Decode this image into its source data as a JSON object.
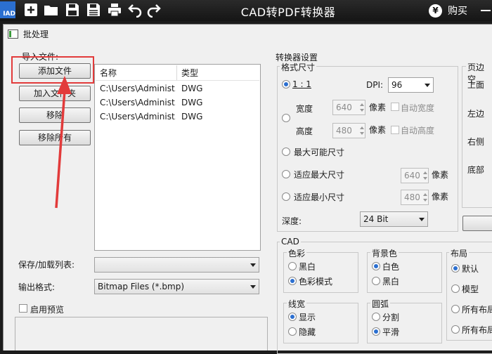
{
  "app": {
    "logo_text": "IAD",
    "title": "CAD转PDF转换器",
    "buy_symbol": "¥",
    "buy_label": "购买",
    "toolbar_icons": [
      "new-icon",
      "open-folder-icon",
      "save-icon",
      "save-as-icon",
      "print-icon",
      "undo-icon",
      "redo-icon"
    ]
  },
  "dialog": {
    "title": "批处理",
    "input_group_label": "导入文件:",
    "buttons": {
      "add_file": "添加文件",
      "add_folder": "加入文件夹",
      "remove": "移除",
      "remove_all": "移除所有"
    },
    "file_list": {
      "columns": [
        "名称",
        "类型"
      ],
      "rows": [
        {
          "name": "C:\\Users\\Administ...",
          "type": "DWG"
        },
        {
          "name": "C:\\Users\\Administ...",
          "type": "DWG"
        },
        {
          "name": "C:\\Users\\Administ...",
          "type": "DWG"
        }
      ]
    },
    "save_load_label": "保存/加载列表:",
    "save_load_value": "",
    "output_format_label": "输出格式:",
    "output_format_value": "Bitmap Files (*.bmp)",
    "enable_preview_label": "启用预览",
    "enable_preview_checked": false
  },
  "converter": {
    "title": "转换器设置",
    "format_size_title": "格式尺寸",
    "ratio_label": "1 : 1",
    "dpi_label": "DPI:",
    "dpi_value": "96",
    "width_label": "宽度",
    "width_value": "640",
    "height_label": "高度",
    "height_value": "480",
    "pixel_unit": "像素",
    "auto_width_label": "自动宽度",
    "auto_height_label": "自动高度",
    "max_possible_label": "最大可能尺寸",
    "fit_max_label": "适应最大尺寸",
    "fit_max_value": "640",
    "fit_min_label": "适应最小尺寸",
    "fit_min_value": "480",
    "depth_label": "深度:",
    "depth_value": "24 Bit",
    "size_mode_selected": "1 : 1"
  },
  "margins": {
    "title": "页边空",
    "top": "上面",
    "left": "左边",
    "right": "右侧",
    "bottom": "底部"
  },
  "cad": {
    "title": "CAD",
    "color": {
      "title": "色彩",
      "options": [
        "黑白",
        "色彩模式"
      ],
      "selected": "色彩模式"
    },
    "background": {
      "title": "背景色",
      "options": [
        "白色",
        "黑白"
      ],
      "selected": "白色"
    },
    "layout": {
      "title": "布局",
      "options": [
        "默认",
        "模型",
        "所有布局",
        "所有布局"
      ],
      "selected": "默认"
    },
    "lineweight": {
      "title": "线宽",
      "options": [
        "显示",
        "隐藏"
      ],
      "selected": "显示"
    },
    "arc": {
      "title": "圆弧",
      "options": [
        "分割",
        "平滑"
      ],
      "selected": "平滑"
    }
  },
  "colors": {
    "highlight_red": "#e23b3b",
    "accent_blue": "#2b6fd0",
    "appbar": "#1c1c1c"
  }
}
